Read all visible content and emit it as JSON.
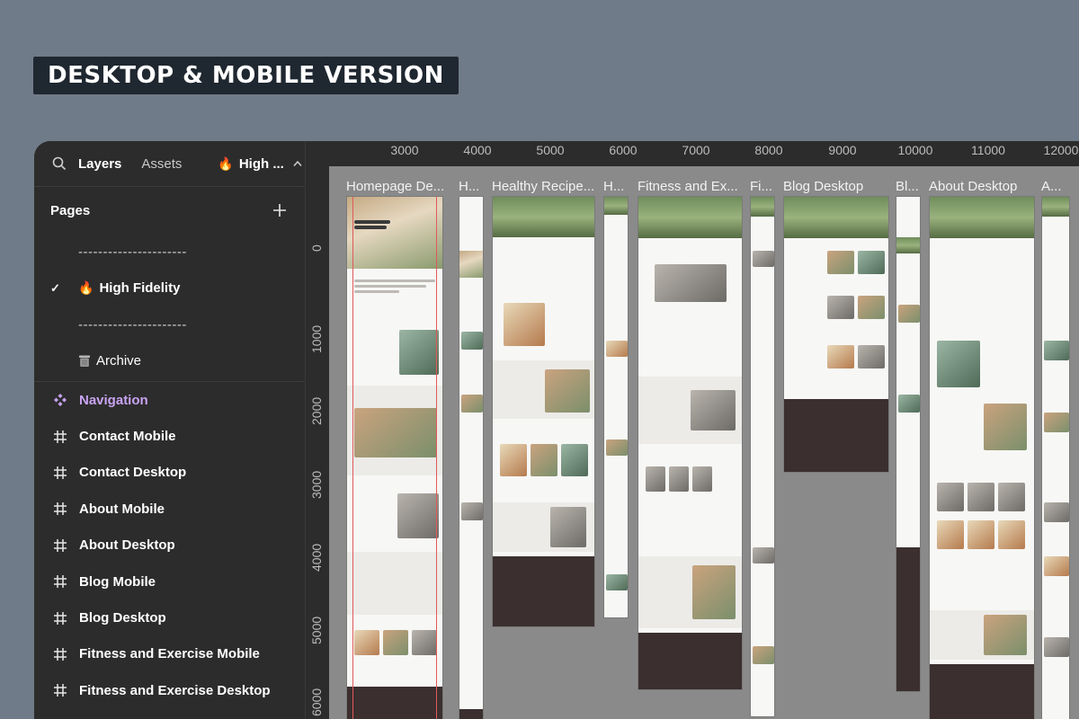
{
  "banner": {
    "title": "DESKTOP & MOBILE VERSION"
  },
  "sidebar": {
    "tabs": {
      "layers": "Layers",
      "assets": "Assets",
      "page_emoji": "🔥",
      "page_name": "High ..."
    },
    "pages_header": "Pages",
    "pages": [
      {
        "label": "----------------------",
        "type": "divider"
      },
      {
        "label": "High Fidelity",
        "emoji": "🔥",
        "active": true
      },
      {
        "label": "----------------------",
        "type": "divider"
      },
      {
        "label": "Archive",
        "icon": "trash-icon"
      }
    ],
    "layers": [
      {
        "label": "Navigation",
        "icon": "component-icon"
      },
      {
        "label": "Contact Mobile",
        "icon": "frame-icon"
      },
      {
        "label": "Contact Desktop",
        "icon": "frame-icon"
      },
      {
        "label": "About Mobile",
        "icon": "frame-icon"
      },
      {
        "label": "About Desktop",
        "icon": "frame-icon"
      },
      {
        "label": "Blog Mobile",
        "icon": "frame-icon"
      },
      {
        "label": "Blog Desktop",
        "icon": "frame-icon"
      },
      {
        "label": "Fitness and Exercise Mobile",
        "icon": "frame-icon"
      },
      {
        "label": "Fitness and Exercise Desktop",
        "icon": "frame-icon"
      }
    ]
  },
  "canvas": {
    "ruler_x": [
      "3000",
      "4000",
      "5000",
      "6000",
      "7000",
      "8000",
      "9000",
      "10000",
      "11000",
      "12000"
    ],
    "ruler_y": [
      "0",
      "1000",
      "2000",
      "3000",
      "4000",
      "5000",
      "6000"
    ],
    "frames": [
      {
        "label": "Homepage De..."
      },
      {
        "label": "H..."
      },
      {
        "label": "Healthy Recipe..."
      },
      {
        "label": "H..."
      },
      {
        "label": "Fitness and Ex..."
      },
      {
        "label": "Fi..."
      },
      {
        "label": "Blog Desktop"
      },
      {
        "label": "Bl..."
      },
      {
        "label": "About Desktop"
      },
      {
        "label": "A..."
      }
    ]
  },
  "colors": {
    "accent_component": "#c9a3f2",
    "canvas": "#8a8a8a",
    "panel": "#2c2c2c",
    "footer": "#3b2f2f"
  }
}
